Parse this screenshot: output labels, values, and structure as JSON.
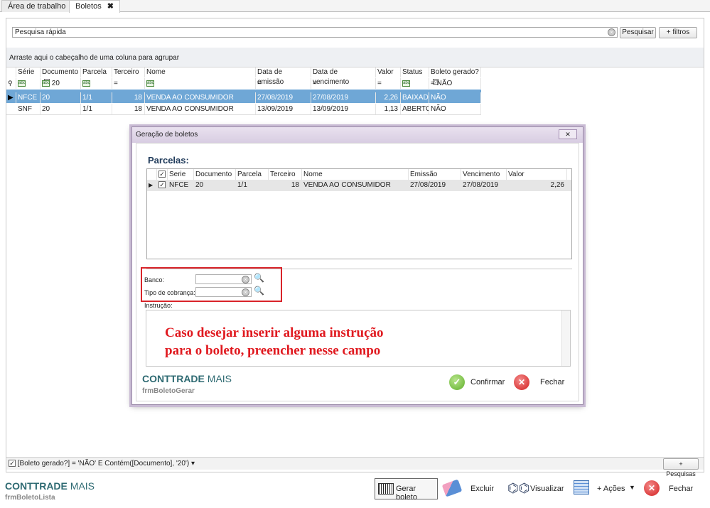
{
  "tabs": [
    {
      "label": "Área de trabalho"
    },
    {
      "label": "Boletos",
      "close": "✖"
    }
  ],
  "search": {
    "placeholder": "Pesquisa rápida",
    "button": "Pesquisar",
    "filters": "+ filtros"
  },
  "group_hint": "Arraste aqui o cabeçalho de uma coluna para agrupar",
  "grid": {
    "columns": [
      "Série",
      "Documento",
      "Parcela",
      "Terceiro",
      "Nome",
      "Data de emissão",
      "Data de vencimento",
      "Valor",
      "Status",
      "Boleto gerado?"
    ],
    "filter_row": {
      "documento": "20",
      "boleto_gerado": "= NÃO"
    },
    "rows": [
      [
        "NFCE",
        "20",
        "1/1",
        "18",
        "VENDA AO CONSUMIDOR",
        "27/08/2019",
        "27/08/2019",
        "2,26",
        "BAIXADO",
        "NÃO"
      ],
      [
        "SNF",
        "20",
        "1/1",
        "18",
        "VENDA AO CONSUMIDOR",
        "13/09/2019",
        "13/09/2019",
        "1,13",
        "ABERTO",
        "NÃO"
      ]
    ]
  },
  "dialog": {
    "title": "Geração de boletos",
    "parcelas_label": "Parcelas:",
    "columns": [
      "Serie",
      "Documento",
      "Parcela",
      "Terceiro",
      "Nome",
      "Emissão",
      "Vencimento",
      "Valor"
    ],
    "rows": [
      [
        "NFCE",
        "20",
        "1/1",
        "18",
        "VENDA AO CONSUMIDOR",
        "27/08/2019",
        "27/08/2019",
        "2,26"
      ]
    ],
    "banco_label": "Banco:",
    "tipo_label": "Tipo de cobrança:",
    "instrucao_label": "Instrução:",
    "note_line1": "Caso desejar inserir alguma instrução",
    "note_line2": "para o boleto, preencher nesse campo",
    "brand_bold": "CONTTRADE",
    "brand_rest": " MAIS",
    "form_name": "frmBoletoGerar",
    "confirm": "Confirmar",
    "close": "Fechar"
  },
  "filter_status": "[Boleto gerado?] = 'NÃO' E Contém([Documento], '20')",
  "pesquisas_btn": "+ Pesquisas",
  "footer": {
    "brand_bold": "CONTTRADE",
    "brand_rest": " MAIS",
    "form_name": "frmBoletoLista",
    "gerar": "Gerar boleto",
    "excluir": "Excluir",
    "visualizar": "Visualizar",
    "acoes": "+ Ações",
    "fechar": "Fechar"
  }
}
